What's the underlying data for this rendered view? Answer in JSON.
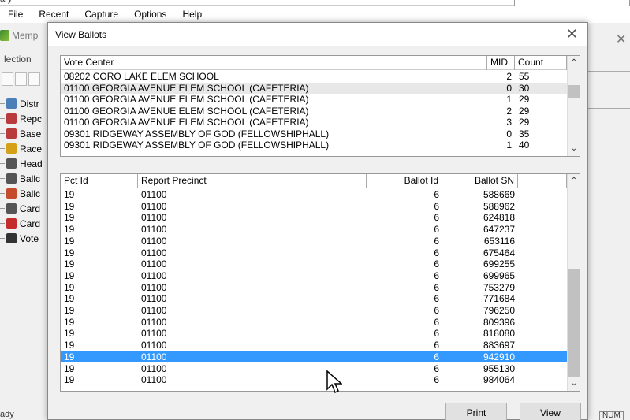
{
  "menu": [
    "File",
    "Recent",
    "Capture",
    "Options",
    "Help"
  ],
  "top_strip_text": "ary",
  "app": {
    "title": "Memp",
    "tab": "lection",
    "tree": [
      {
        "label": "Distr",
        "color": "#4a7fb8"
      },
      {
        "label": "Repc",
        "color": "#b83a3a"
      },
      {
        "label": "Base",
        "color": "#b83a3a"
      },
      {
        "label": "Race",
        "color": "#d4a017"
      },
      {
        "label": "Head",
        "color": "#555555"
      },
      {
        "label": "Ballc",
        "color": "#555555"
      },
      {
        "label": "Ballc",
        "color": "#c44b2b"
      },
      {
        "label": "Card",
        "color": "#555555"
      },
      {
        "label": "Card",
        "color": "#c42b2b"
      },
      {
        "label": "Vote",
        "color": "#333333"
      }
    ],
    "status": "ady",
    "status_num": "NUM"
  },
  "dialog": {
    "title": "View Ballots",
    "close": "✕",
    "top_grid": {
      "headers": [
        "Vote Center",
        "MID",
        "Count"
      ],
      "rows": [
        [
          "08202 CORO LAKE ELEM SCHOOL",
          "2",
          "55"
        ],
        [
          "01100 GEORGIA AVENUE  ELEM SCHOOL (CAFETERIA)",
          "0",
          "30"
        ],
        [
          "01100 GEORGIA AVENUE  ELEM SCHOOL (CAFETERIA)",
          "1",
          "29"
        ],
        [
          "01100 GEORGIA AVENUE  ELEM SCHOOL (CAFETERIA)",
          "2",
          "29"
        ],
        [
          "01100 GEORGIA AVENUE  ELEM SCHOOL (CAFETERIA)",
          "3",
          "29"
        ],
        [
          "09301 RIDGEWAY ASSEMBLY OF GOD  (FELLOWSHIPHALL)",
          "0",
          "35"
        ],
        [
          "09301 RIDGEWAY ASSEMBLY OF GOD  (FELLOWSHIPHALL)",
          "1",
          "40"
        ]
      ],
      "highlighted_row": 1
    },
    "bottom_grid": {
      "headers": [
        "Pct Id",
        "Report Precinct",
        "Ballot Id",
        "Ballot SN"
      ],
      "rows": [
        [
          "19",
          "01100",
          "6",
          "588669"
        ],
        [
          "19",
          "01100",
          "6",
          "588962"
        ],
        [
          "19",
          "01100",
          "6",
          "624818"
        ],
        [
          "19",
          "01100",
          "6",
          "647237"
        ],
        [
          "19",
          "01100",
          "6",
          "653116"
        ],
        [
          "19",
          "01100",
          "6",
          "675464"
        ],
        [
          "19",
          "01100",
          "6",
          "699255"
        ],
        [
          "19",
          "01100",
          "6",
          "699965"
        ],
        [
          "19",
          "01100",
          "6",
          "753279"
        ],
        [
          "19",
          "01100",
          "6",
          "771684"
        ],
        [
          "19",
          "01100",
          "6",
          "796250"
        ],
        [
          "19",
          "01100",
          "6",
          "809396"
        ],
        [
          "19",
          "01100",
          "6",
          "818080"
        ],
        [
          "19",
          "01100",
          "6",
          "883697"
        ],
        [
          "19",
          "01100",
          "6",
          "942910"
        ],
        [
          "19",
          "01100",
          "6",
          "955130"
        ],
        [
          "19",
          "01100",
          "6",
          "984064"
        ]
      ],
      "selected_row": 14
    },
    "buttons": {
      "print": "Print",
      "view": "View"
    }
  }
}
